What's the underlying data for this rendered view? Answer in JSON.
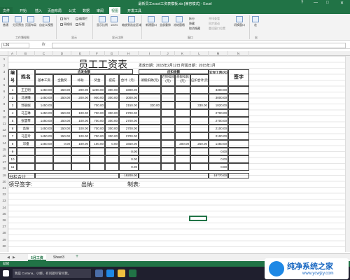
{
  "window": {
    "title": "最新员工excel工资表模板.xls [兼容模式] - Excel",
    "help": "?",
    "min": "—",
    "max": "□",
    "close": "✕"
  },
  "tabs": [
    "文件",
    "开始",
    "插入",
    "页面布局",
    "公式",
    "数据",
    "审阅",
    "视图",
    "开发工具"
  ],
  "active_tab": "视图",
  "ribbon": {
    "view_buttons": [
      "普通",
      "分页预览",
      "页面布局",
      "自定义视图"
    ],
    "group_workbook_views": "工作簿视图",
    "show_items": [
      {
        "label": "标尺",
        "checked": false
      },
      {
        "label": "编辑栏",
        "checked": true
      },
      {
        "label": "网格线",
        "checked": true
      },
      {
        "label": "标题",
        "checked": true
      }
    ],
    "group_show": "显示",
    "zoom_buttons": [
      "显示比例",
      "100%",
      "缩放到选定区域"
    ],
    "group_zoom": "显示比例",
    "window_buttons": [
      "新建窗口",
      "全部重排",
      "冻结窗格"
    ],
    "window_small": [
      "拆分",
      "隐藏",
      "取消隐藏"
    ],
    "window_small2": [
      "并排查看",
      "同步滚动",
      "重设窗口位置"
    ],
    "switch_window": "切换窗口",
    "group_window": "窗口",
    "macros": "宏",
    "group_macros": "宏"
  },
  "formula_bar": {
    "name_box": "L26",
    "fx": "fx",
    "value": ""
  },
  "columns": [
    "A",
    "B",
    "C",
    "D",
    "E",
    "F",
    "G",
    "H",
    "I",
    "J",
    "K",
    "L",
    "M",
    "N"
  ],
  "rows": [
    "1",
    "2",
    "3",
    "4",
    "5",
    "6",
    "7",
    "8",
    "9",
    "10",
    "11",
    "12",
    "13",
    "14",
    "15",
    "16",
    "17",
    "18",
    "19",
    "20",
    "21",
    "22",
    "23",
    "24",
    "25",
    "26",
    "27",
    "28",
    "29",
    "30"
  ],
  "sheet": {
    "title": "员工工资表",
    "pay_date": "发放日期：2015年2月12日 所属日期：2015年1月",
    "h_no": "编号",
    "h_name": "姓名",
    "h_should": "应发金额",
    "h_deduct": "应扣金额",
    "h_base": "基本工资",
    "h_post": "全勤奖",
    "h_subsidy": "补助",
    "h_bonus": "奖金",
    "h_overtime": "提成",
    "h_total": "合计（元）",
    "h_late": "请假扣款(元)",
    "h_absent": "迟到扣款(元)",
    "h_leave": "病假扣款(元)",
    "h_deduct_total": "应扣合计(元)",
    "h_actual": "实发工资(元)",
    "h_sign": "签字",
    "employees": [
      {
        "no": "1",
        "name": "王卫明",
        "v": [
          "1450.00",
          "150.00",
          "200.00",
          "1200.00",
          "300.00",
          "3300.00",
          "",
          "",
          "",
          "",
          "3300.00"
        ]
      },
      {
        "no": "2",
        "name": "马涵曦",
        "v": [
          "1450.00",
          "150.00",
          "200.00",
          "900.00",
          "300.00",
          "3000.00",
          "",
          "",
          "",
          "",
          "3000.00"
        ]
      },
      {
        "no": "3",
        "name": "郭丽妮",
        "v": [
          "1450.00",
          "",
          "",
          "700.00",
          "",
          "2150.00",
          "330.00",
          "",
          "",
          "330.00",
          "1820.00"
        ]
      },
      {
        "no": "4",
        "name": "马玉琳",
        "v": [
          "1450.00",
          "150.00",
          "100.00",
          "700.00",
          "300.00",
          "2700.00",
          "",
          "",
          "",
          "",
          "2700.00"
        ]
      },
      {
        "no": "5",
        "name": "张慧琴",
        "v": [
          "1450.00",
          "150.00",
          "100.00",
          "700.00",
          "300.00",
          "2700.00",
          "",
          "",
          "",
          "",
          "2700.00"
        ]
      },
      {
        "no": "6",
        "name": "高阳",
        "v": [
          "1450.00",
          "150.00",
          "100.00",
          "700.00",
          "300.00",
          "2700.00",
          "",
          "",
          "",
          "",
          "2100.00"
        ]
      },
      {
        "no": "7",
        "name": "马亚玲",
        "v": [
          "1450.00",
          "150.00",
          "100.00",
          "700.00",
          "300.00",
          "2700.00",
          "",
          "",
          "",
          "",
          "2100.00"
        ]
      },
      {
        "no": "8",
        "name": "邓睿",
        "v": [
          "1450.00",
          "0.00",
          "100.00",
          "100.00",
          "0.00",
          "1650.00",
          "",
          "",
          "200.00",
          "250.00",
          "1450.00"
        ]
      },
      {
        "no": "9",
        "name": "",
        "v": [
          "",
          "",
          "",
          "",
          "",
          "0.00",
          "",
          "",
          "",
          "",
          "0.00"
        ]
      },
      {
        "no": "10",
        "name": "",
        "v": [
          "",
          "",
          "",
          "",
          "",
          "0.00",
          "",
          "",
          "",
          "",
          "0.00"
        ]
      },
      {
        "no": "11",
        "name": "",
        "v": [
          "",
          "",
          "",
          "",
          "",
          "0.00",
          "",
          "",
          "",
          "",
          "0.00"
        ]
      }
    ],
    "subtotal_label": "分栏合计",
    "subtotal_total": "19200.00",
    "subtotal_actual": "18770.00",
    "footer_leader": "领导签字:",
    "footer_cashier": "出纳:",
    "footer_maker": "制表:"
  },
  "sheet_tabs": [
    "5月工资",
    "Sheet3"
  ],
  "active_sheet": "5月工资",
  "add_sheet": "+",
  "status": {
    "ready": "就绪",
    "zoom": "—————+ 100%"
  },
  "taskbar": {
    "search": "我是 Cortana，小娜。有问题尽管问我。"
  },
  "watermark": {
    "brand": "纯净系统之家",
    "url": "www.ycwjzy.com"
  },
  "colors": {
    "excel_green": "#217346",
    "header_gray": "#f0f0f0"
  }
}
